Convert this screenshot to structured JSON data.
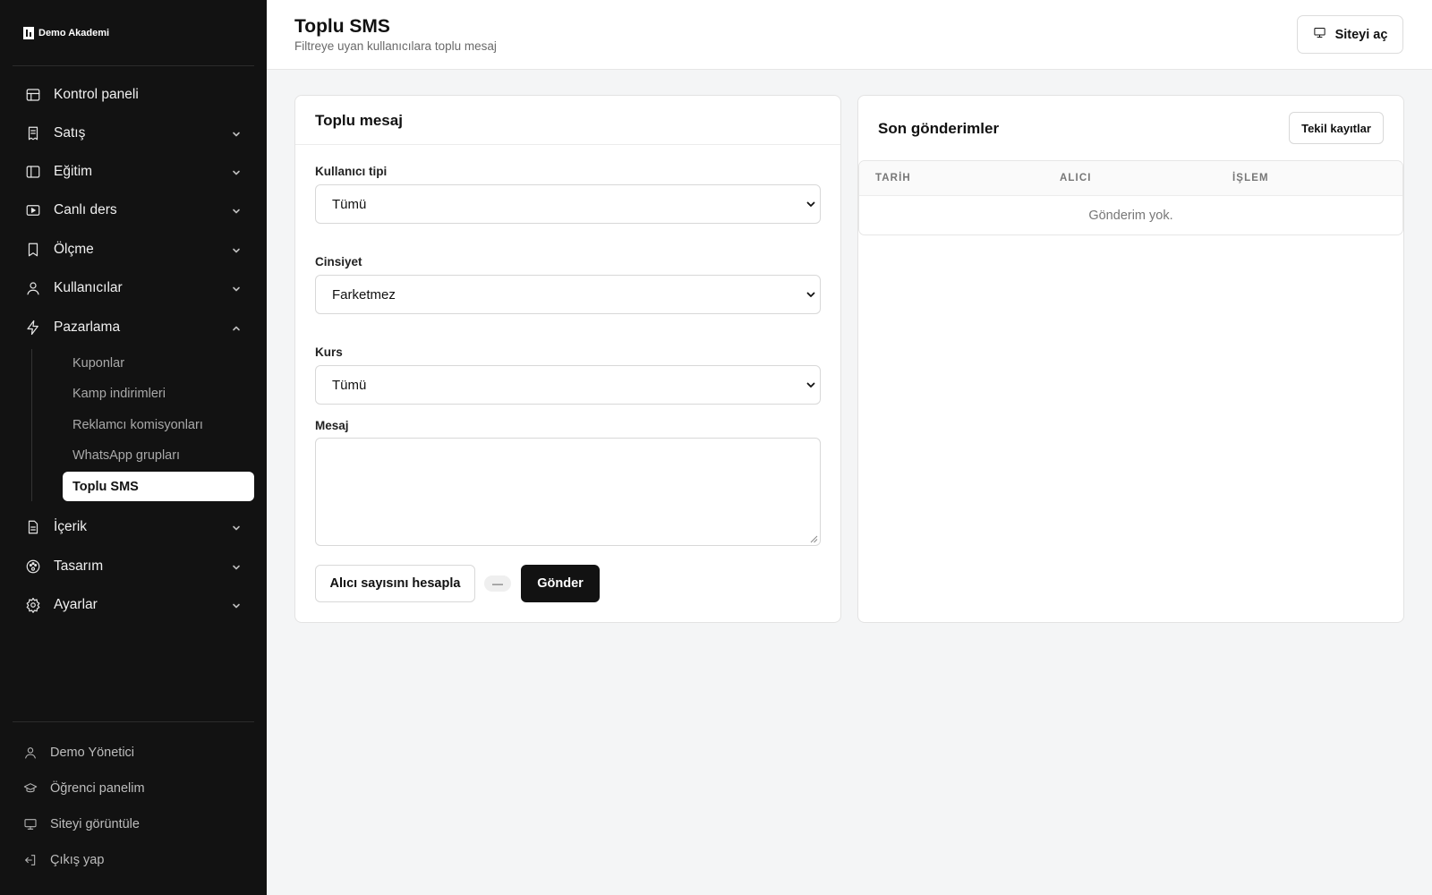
{
  "brand": {
    "name": "Demo Akademi"
  },
  "sidebar": {
    "items": [
      {
        "label": "Kontrol paneli",
        "icon": "layout-icon"
      },
      {
        "label": "Satış",
        "icon": "receipt-icon"
      },
      {
        "label": "Eğitim",
        "icon": "sidebar-panel-icon"
      },
      {
        "label": "Canlı ders",
        "icon": "video-icon"
      },
      {
        "label": "Ölçme",
        "icon": "bookmark-icon"
      },
      {
        "label": "Kullanıcılar",
        "icon": "user-icon"
      },
      {
        "label": "Pazarlama",
        "icon": "lightning-icon",
        "expanded": true
      },
      {
        "label": "İçerik",
        "icon": "file-icon"
      },
      {
        "label": "Tasarım",
        "icon": "palette-icon"
      },
      {
        "label": "Ayarlar",
        "icon": "gear-icon"
      }
    ],
    "sub_items": [
      {
        "label": "Kuponlar"
      },
      {
        "label": "Kamp indirimleri"
      },
      {
        "label": "Reklamcı komisyonları"
      },
      {
        "label": "WhatsApp grupları"
      },
      {
        "label": "Toplu SMS",
        "active": true
      }
    ],
    "footer": [
      {
        "label": "Demo Yönetici",
        "icon": "user-icon"
      },
      {
        "label": "Öğrenci panelim",
        "icon": "graduation-cap-icon"
      },
      {
        "label": "Siteyi görüntüle",
        "icon": "monitor-icon"
      },
      {
        "label": "Çıkış yap",
        "icon": "logout-icon"
      }
    ]
  },
  "header": {
    "title": "Toplu SMS",
    "subtitle": "Filtreye uyan kullanıcılara toplu mesaj",
    "open_site_label": "Siteyi aç"
  },
  "form": {
    "title": "Toplu mesaj",
    "user_type": {
      "label": "Kullanıcı tipi",
      "value": "Tümü"
    },
    "gender": {
      "label": "Cinsiyet",
      "value": "Farketmez"
    },
    "course": {
      "label": "Kurs",
      "value": "Tümü"
    },
    "message": {
      "label": "Mesaj",
      "value": ""
    },
    "calc_label": "Alıcı sayısını hesapla",
    "count_value": "—",
    "send_label": "Gönder"
  },
  "recent": {
    "title": "Son gönderimler",
    "unique_records_label": "Tekil kayıtlar",
    "columns": [
      "TARİH",
      "ALICI",
      "İŞLEM"
    ],
    "empty_text": "Gönderim yok."
  },
  "colors": {
    "sidebar_bg": "#121212",
    "page_bg": "#f4f5f6",
    "primary_button": "#121212"
  }
}
